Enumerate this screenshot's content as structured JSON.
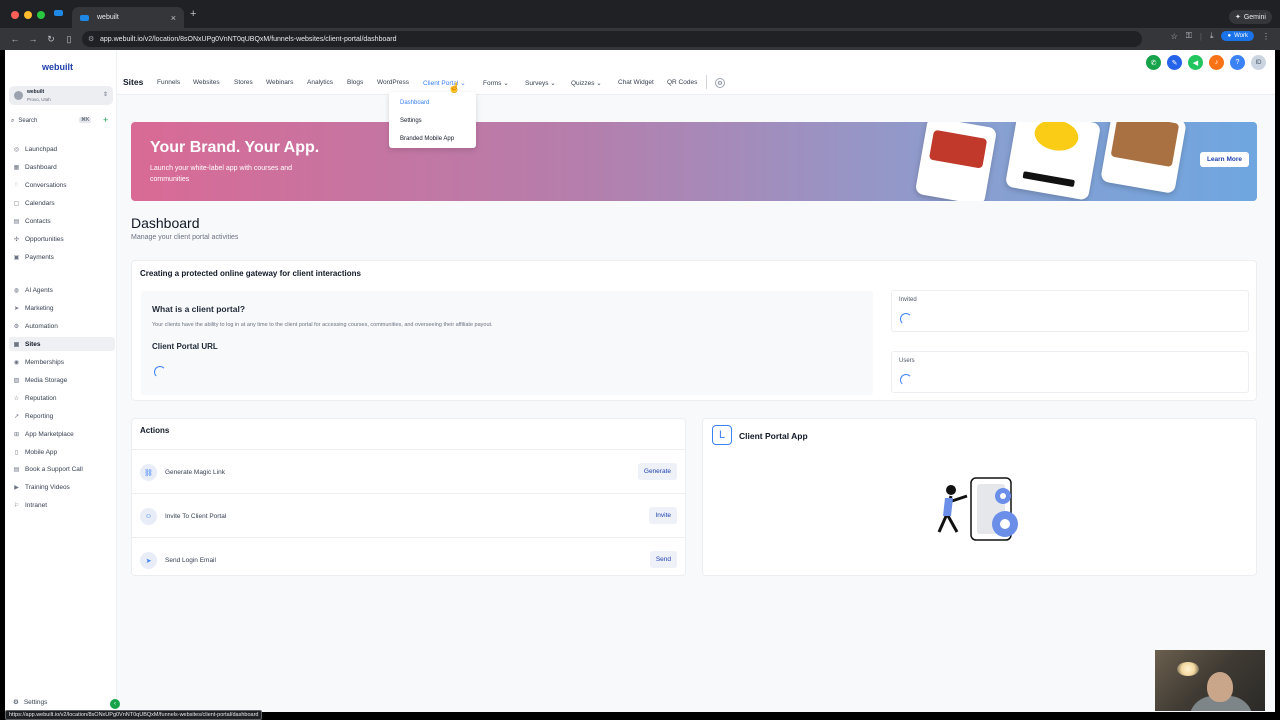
{
  "browser": {
    "tab_title": "webuilt",
    "url": "app.webuilt.io/v2/location/8sONxUPg0VnNT0qUBQxM/funnels-websites/client-portal/dashboard",
    "gemini_label": "Gemini",
    "profile_label": "Work",
    "status_url": "https://app.webuilt.io/v2/location/8sONxUPg0VnNT0qUBQxM/funnels-websites/client-portal/dashboard"
  },
  "sidebar": {
    "logo": "webuilt",
    "account_name": "webuilt",
    "account_location": "Provo, Utah",
    "search_label": "Search",
    "search_shortcut": "⌘K",
    "items": [
      {
        "label": "Launchpad"
      },
      {
        "label": "Dashboard"
      },
      {
        "label": "Conversations"
      },
      {
        "label": "Calendars"
      },
      {
        "label": "Contacts"
      },
      {
        "label": "Opportunities"
      },
      {
        "label": "Payments"
      },
      {
        "label": "AI Agents"
      },
      {
        "label": "Marketing"
      },
      {
        "label": "Automation"
      },
      {
        "label": "Sites"
      },
      {
        "label": "Memberships"
      },
      {
        "label": "Media Storage"
      },
      {
        "label": "Reputation"
      },
      {
        "label": "Reporting"
      },
      {
        "label": "App Marketplace"
      },
      {
        "label": "Mobile App"
      },
      {
        "label": "Book a Support Call"
      },
      {
        "label": "Training Videos"
      },
      {
        "label": "Intranet"
      }
    ],
    "settings_label": "Settings"
  },
  "topnav": {
    "title": "Sites",
    "items": [
      "Funnels",
      "Websites",
      "Stores",
      "Webinars",
      "Analytics",
      "Blogs",
      "WordPress",
      "Client Portal",
      "Forms",
      "Surveys",
      "Quizzes",
      "Chat Widget",
      "QR Codes"
    ],
    "active": "Client Portal",
    "avatar_initials": "ID"
  },
  "dropdown": {
    "items": [
      "Dashboard",
      "Settings",
      "Branded Mobile App"
    ]
  },
  "banner": {
    "title": "Your Brand. Your App.",
    "subtitle": "Launch your white-label app with courses and communities",
    "cta": "Learn More"
  },
  "dashboard": {
    "title": "Dashboard",
    "subtitle": "Manage your client portal activities"
  },
  "gateway": {
    "title": "Creating a protected online gateway for client interactions",
    "what_title": "What is a client portal?",
    "what_desc": "Your clients have the ability to log in at any time to the client portal for accessing courses, communities, and overseeing their affiliate payout.",
    "url_title": "Client Portal URL",
    "invited_label": "Invited",
    "users_label": "Users"
  },
  "actions": {
    "title": "Actions",
    "rows": [
      {
        "label": "Generate Magic Link",
        "button": "Generate"
      },
      {
        "label": "Invite To Client Portal",
        "button": "Invite"
      },
      {
        "label": "Send Login Email",
        "button": "Send"
      }
    ]
  },
  "client_app": {
    "title": "Client Portal App"
  }
}
